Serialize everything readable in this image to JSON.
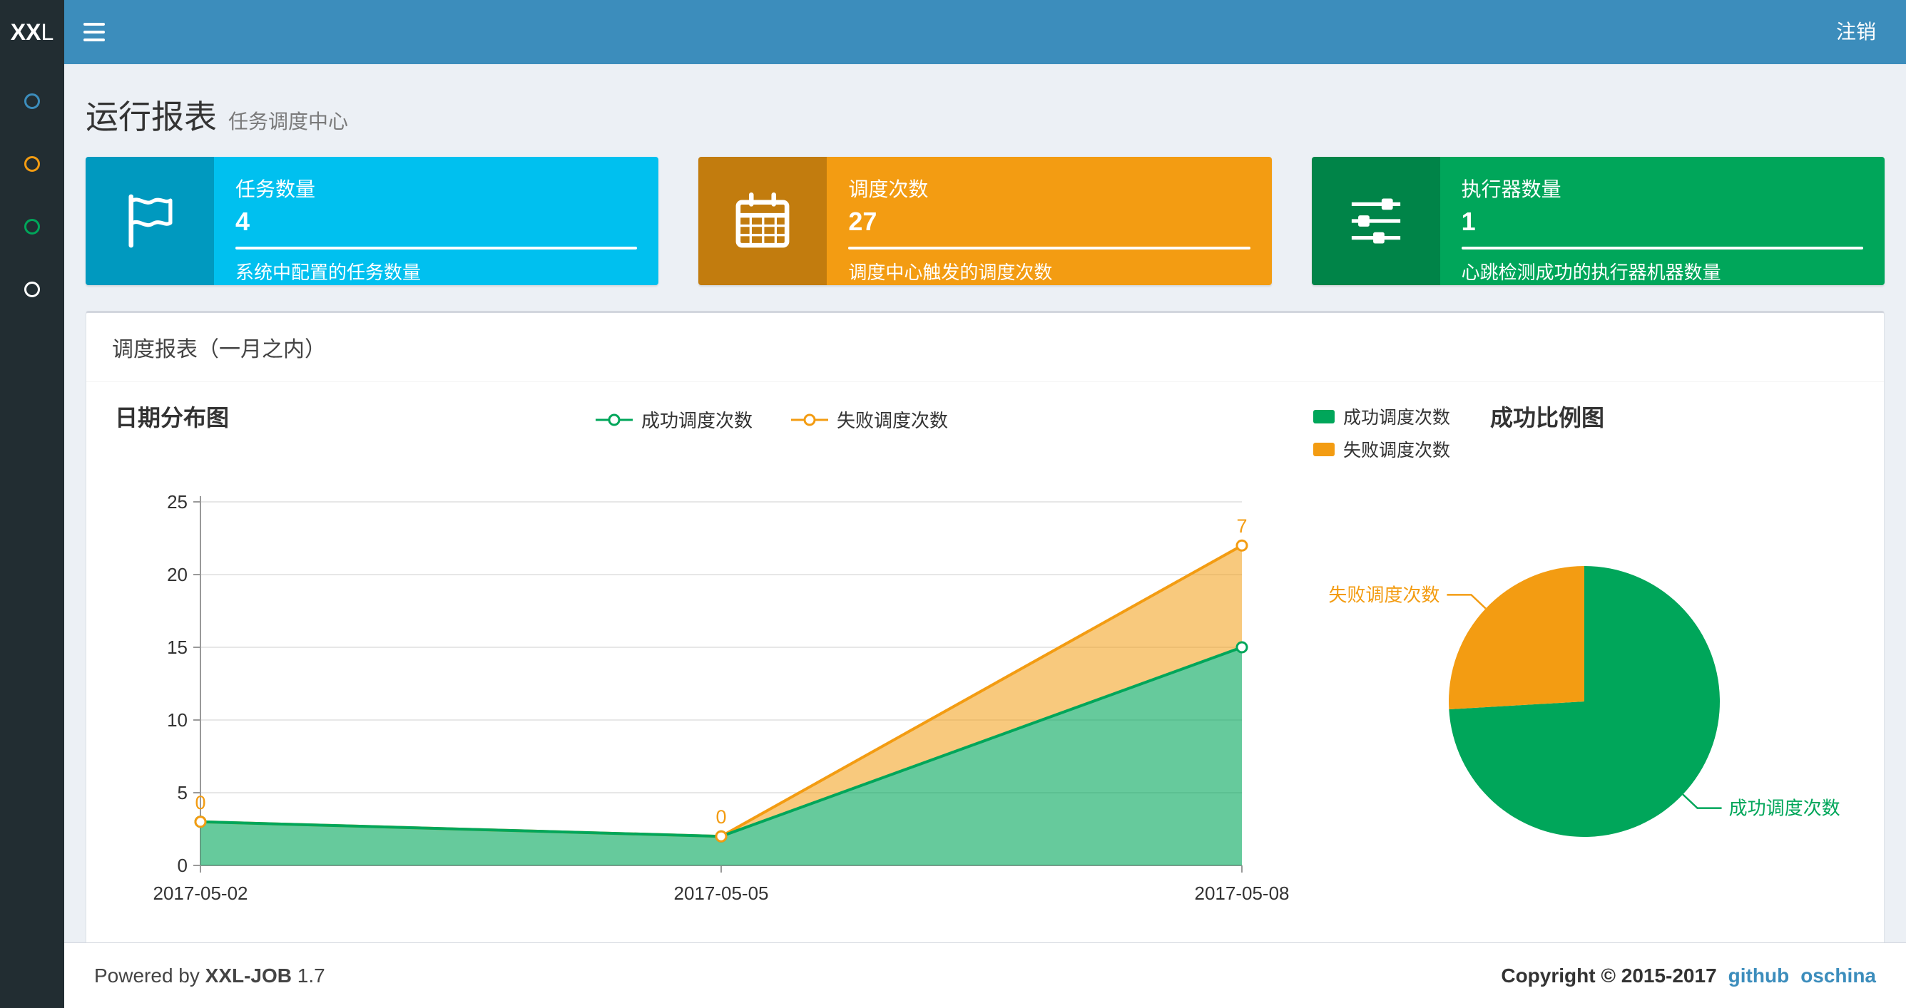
{
  "navbar": {
    "logo_bold": "XX",
    "logo_light": "L",
    "logout": "注销"
  },
  "sidebar": {
    "items": [
      {
        "icon": "circle-icon",
        "color": "#3c8dbc"
      },
      {
        "icon": "circle-icon",
        "color": "#f39c12"
      },
      {
        "icon": "circle-icon",
        "color": "#00a65a"
      },
      {
        "icon": "circle-icon",
        "color": "#ffffff"
      }
    ]
  },
  "page": {
    "title": "运行报表",
    "subtitle": "任务调度中心"
  },
  "info_boxes": [
    {
      "label": "任务数量",
      "value": "4",
      "desc": "系统中配置的任务数量",
      "color": "#00c0ef",
      "icon": "flag-icon"
    },
    {
      "label": "调度次数",
      "value": "27",
      "desc": "调度中心触发的调度次数",
      "color": "#f39c12",
      "icon": "calendar-icon"
    },
    {
      "label": "执行器数量",
      "value": "1",
      "desc": "心跳检测成功的执行器机器数量",
      "color": "#00a65a",
      "icon": "sliders-icon"
    }
  ],
  "panel": {
    "title": "调度报表（一月之内）"
  },
  "chart_data": [
    {
      "type": "area",
      "title": "日期分布图",
      "x": [
        "2017-05-02",
        "2017-05-05",
        "2017-05-08"
      ],
      "series": [
        {
          "name": "成功调度次数",
          "color": "#00a65a",
          "values": [
            3,
            2,
            15
          ]
        },
        {
          "name": "失败调度次数",
          "color": "#f39c12",
          "values": [
            0,
            0,
            7
          ]
        }
      ],
      "stacked": true,
      "ylim": [
        0,
        25
      ],
      "yticks": [
        0,
        5,
        10,
        15,
        20,
        25
      ],
      "legend_position": "top",
      "grid": true
    },
    {
      "type": "pie",
      "title": "成功比例图",
      "slices": [
        {
          "name": "成功调度次数",
          "value": 20,
          "color": "#00a65a"
        },
        {
          "name": "失败调度次数",
          "value": 7,
          "color": "#f39c12"
        }
      ],
      "legend_position": "top-left"
    }
  ],
  "footer": {
    "powered_prefix": "Powered by",
    "app": "XXL-JOB",
    "version": "1.7",
    "copyright": "Copyright © 2015-2017",
    "links": [
      "github",
      "oschina"
    ]
  }
}
